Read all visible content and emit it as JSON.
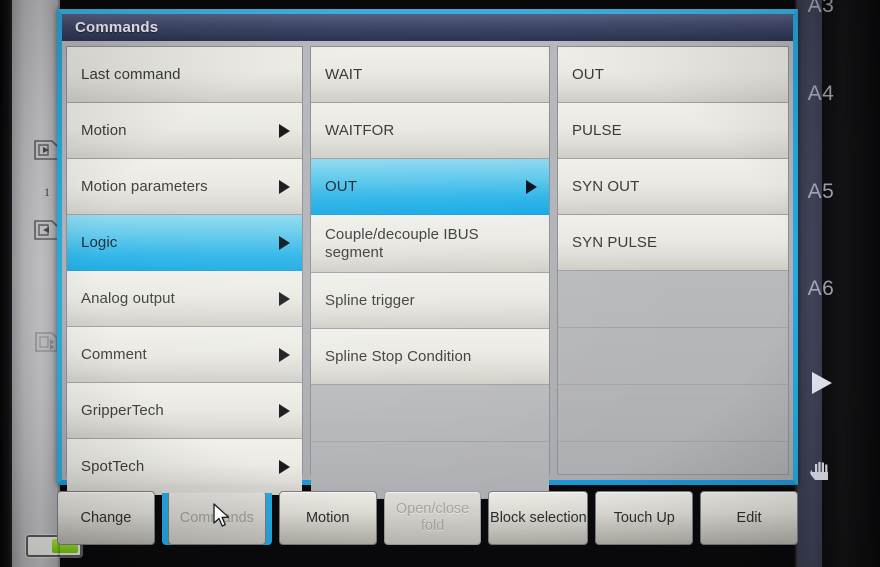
{
  "dialog": {
    "title": "Commands",
    "columns": [
      {
        "name": "command-categories",
        "items": [
          {
            "label": "Last command",
            "arrow": false,
            "selected": false
          },
          {
            "label": "Motion",
            "arrow": true,
            "selected": false
          },
          {
            "label": "Motion parameters",
            "arrow": true,
            "selected": false
          },
          {
            "label": "Logic",
            "arrow": true,
            "selected": true
          },
          {
            "label": "Analog output",
            "arrow": true,
            "selected": false
          },
          {
            "label": "Comment",
            "arrow": true,
            "selected": false
          },
          {
            "label": "GripperTech",
            "arrow": true,
            "selected": false
          },
          {
            "label": "SpotTech",
            "arrow": true,
            "selected": false
          }
        ]
      },
      {
        "name": "logic-commands",
        "items": [
          {
            "label": "WAIT",
            "arrow": false,
            "selected": false
          },
          {
            "label": "WAITFOR",
            "arrow": false,
            "selected": false
          },
          {
            "label": "OUT",
            "arrow": true,
            "selected": true
          },
          {
            "label": "Couple/decouple IBUS segment",
            "arrow": false,
            "selected": false
          },
          {
            "label": "Spline trigger",
            "arrow": false,
            "selected": false
          },
          {
            "label": "Spline Stop Condition",
            "arrow": false,
            "selected": false
          }
        ]
      },
      {
        "name": "out-commands",
        "items": [
          {
            "label": "OUT",
            "arrow": false,
            "selected": false
          },
          {
            "label": "PULSE",
            "arrow": false,
            "selected": false
          },
          {
            "label": "SYN OUT",
            "arrow": false,
            "selected": false
          },
          {
            "label": "SYN PULSE",
            "arrow": false,
            "selected": false
          }
        ]
      }
    ]
  },
  "buttonbar": {
    "buttons": [
      {
        "label": "Change",
        "state": "normal"
      },
      {
        "label": "Commands",
        "state": "active-tab"
      },
      {
        "label": "Motion",
        "state": "normal"
      },
      {
        "label": "Open/close fold",
        "state": "disabled"
      },
      {
        "label": "Block selection",
        "state": "normal"
      },
      {
        "label": "Touch Up",
        "state": "normal"
      },
      {
        "label": "Edit",
        "state": "normal"
      }
    ]
  },
  "left_panel": {
    "step_number": "1",
    "icons": [
      "step-forward-icon",
      "step-backward-icon",
      "motion-toggle-icon"
    ],
    "battery": "battery-indicator"
  },
  "right_panel": {
    "axis_labels": [
      "A3",
      "A4",
      "A5",
      "A6"
    ],
    "icons": [
      "play-triangle-icon",
      "hand-jog-icon"
    ]
  },
  "colors": {
    "accent": "#26a9e0",
    "selection": "#2bb4e8",
    "titlebar": "#2c3354",
    "panel": "#b5b6b8"
  }
}
